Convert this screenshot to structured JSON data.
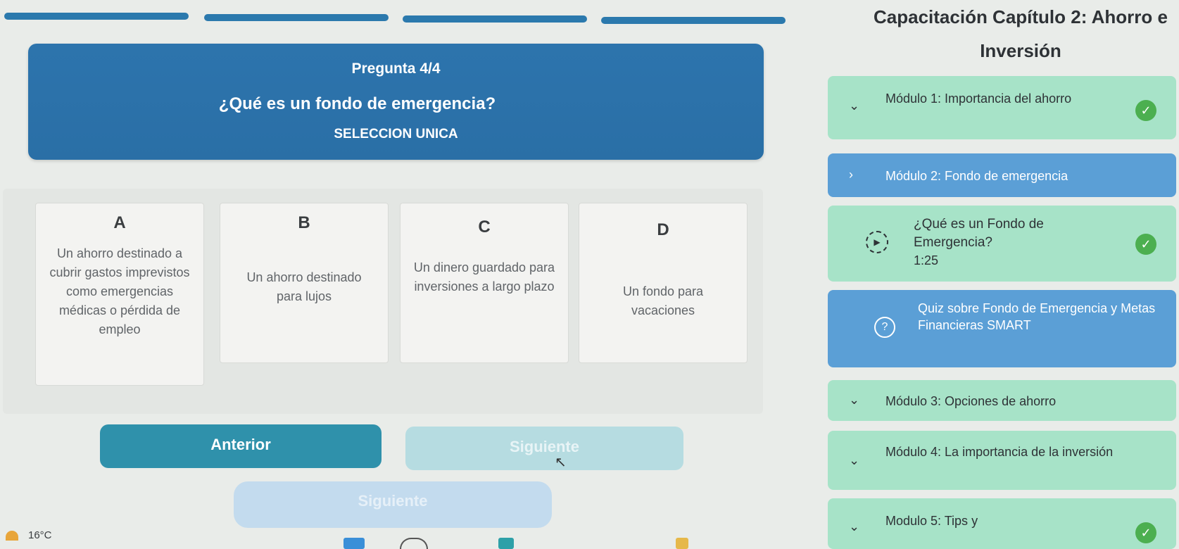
{
  "progress": {
    "segments": [
      {
        "state": "complete"
      },
      {
        "state": "complete"
      },
      {
        "state": "complete"
      },
      {
        "state": "current"
      }
    ]
  },
  "quiz": {
    "question_number": "Pregunta 4/4",
    "question": "¿Qué es un fondo de emergencia?",
    "type": "SELECCION UNICA",
    "options": [
      {
        "letter": "A",
        "text": "Un ahorro destinado a cubrir gastos imprevistos como emergencias médicas o pérdida de empleo"
      },
      {
        "letter": "B",
        "text": "Un ahorro destinado para lujos"
      },
      {
        "letter": "C",
        "text": "Un dinero guardado para inversiones a largo plazo"
      },
      {
        "letter": "D",
        "text": "Un fondo para vacaciones"
      }
    ]
  },
  "nav": {
    "prev_label": "Anterior",
    "next_label": "Siguiente",
    "next2_label": "Siguiente"
  },
  "sidebar": {
    "chapter_title": "Capacitación Capítulo 2: Ahorro e Inversión",
    "modules": [
      {
        "title": "Módulo 1: Importancia del ahorro",
        "completed": true,
        "expanded": false
      },
      {
        "title": "Módulo 2: Fondo de emergencia",
        "completed": false,
        "expanded": true
      },
      {
        "title": "Módulo 3: Opciones de ahorro",
        "completed": false,
        "expanded": false
      },
      {
        "title": "Módulo 4: La importancia de la inversión",
        "completed": false,
        "expanded": false
      },
      {
        "title": "Modulo 5: Tips y",
        "completed": true,
        "expanded": false
      }
    ],
    "lesson": {
      "title": "¿Qué es un Fondo de Emergencia?",
      "duration": "1:25",
      "completed": true
    },
    "quiz_item": {
      "title": "Quiz sobre Fondo de Emergencia y Metas Financieras SMART"
    }
  },
  "taskbar": {
    "temperature": "16°C"
  },
  "colors": {
    "primary": "#2d74ad",
    "module_bg": "#a7e3c8",
    "active_bg": "#5b9fd6",
    "check": "#4caf50",
    "prev_button": "#2f91ab"
  }
}
